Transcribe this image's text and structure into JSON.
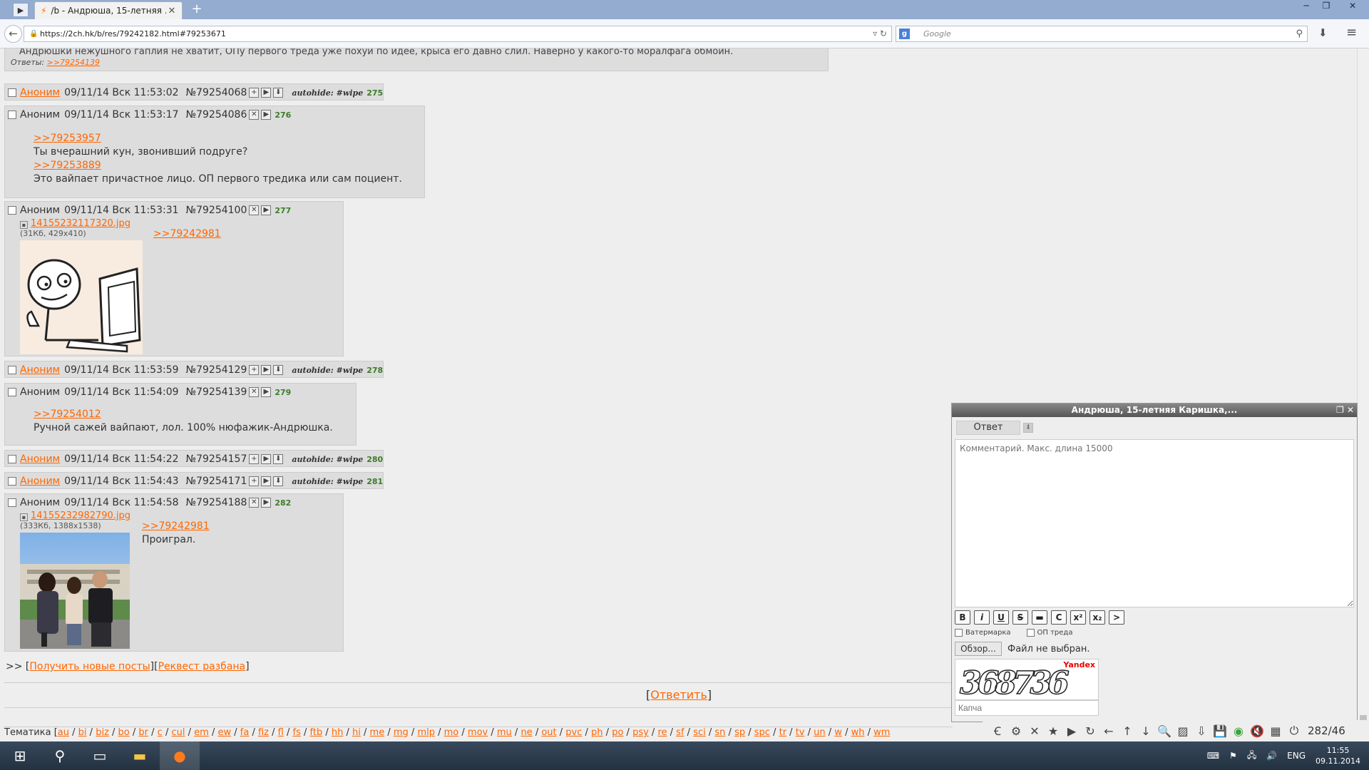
{
  "browser": {
    "tab_title": "/b - Андрюша, 15-летняя ...",
    "url": "https://2ch.hk/b/res/79242182.html#79253671",
    "search_placeholder": "Google"
  },
  "top_post": {
    "text": "Андрюшки нежушного гаплия не хватит, ОПу первого треда уже похуй по идее, крыса его давно слил. Наверно у какого-то моралфага обмоин.",
    "replies_label": "Ответы:",
    "replies_link": ">>79254139"
  },
  "posts": [
    {
      "name": "Аноним",
      "date": "09/11/14 Вск 11:53:02",
      "num": "№79254068",
      "hide": "autohide: #wipe",
      "count": "275"
    },
    {
      "name": "Аноним",
      "date": "09/11/14 Вск 11:53:17",
      "num": "№79254086",
      "count": "276",
      "lines": [
        ">>79253957",
        "Ты вчерашний кун, звонивший подруге?",
        ">>79253889",
        "Это вайпает причастное лицо. ОП первого тредика или сам поциент."
      ]
    },
    {
      "name": "Аноним",
      "date": "09/11/14 Вск 11:53:31",
      "num": "№79254100",
      "count": "277",
      "file": "14155232117320.jpg",
      "file_meta": "(31Кб, 429x410)",
      "lines": [
        ">>79242981"
      ]
    },
    {
      "name": "Аноним",
      "date": "09/11/14 Вск 11:53:59",
      "num": "№79254129",
      "hide": "autohide: #wipe",
      "count": "278"
    },
    {
      "name": "Аноним",
      "date": "09/11/14 Вск 11:54:09",
      "num": "№79254139",
      "count": "279",
      "lines": [
        ">>79254012",
        "Ручной сажей вайпают, лол. 100% нюфажик-Андрюшка."
      ]
    },
    {
      "name": "Аноним",
      "date": "09/11/14 Вск 11:54:22",
      "num": "№79254157",
      "hide": "autohide: #wipe",
      "count": "280"
    },
    {
      "name": "Аноним",
      "date": "09/11/14 Вск 11:54:43",
      "num": "№79254171",
      "hide": "autohide: #wipe",
      "count": "281"
    },
    {
      "name": "Аноним",
      "date": "09/11/14 Вск 11:54:58",
      "num": "№79254188",
      "count": "282",
      "file": "14155232982790.jpg",
      "file_meta": "(333Кб, 1388x1538)",
      "lines": [
        ">>79242981",
        "Проиграл."
      ]
    }
  ],
  "actions": {
    "prefix": ">>",
    "get_new": "Получить новые посты",
    "request_ban": "Реквест разбана",
    "reply": "Ответить"
  },
  "boards_label": "Тематика",
  "boards": [
    "au",
    "bi",
    "biz",
    "bo",
    "br",
    "c",
    "cul",
    "em",
    "ew",
    "fa",
    "fiz",
    "fl",
    "fs",
    "ftb",
    "hh",
    "hi",
    "me",
    "mg",
    "mlp",
    "mo",
    "mov",
    "mu",
    "ne",
    "out",
    "pvc",
    "ph",
    "po",
    "psy",
    "re",
    "sf",
    "sci",
    "sn",
    "sp",
    "spc",
    "tr",
    "tv",
    "un",
    "w",
    "wh",
    "wm"
  ],
  "reply_window": {
    "title": "Андрюша, 15-летняя Каришка,...",
    "tab_label": "Ответ",
    "comment_placeholder": "Комментарий. Макс. длина 15000",
    "format_buttons": [
      "B",
      "i",
      "U",
      "S",
      "▬",
      "C",
      "x²",
      "x₂",
      ">"
    ],
    "watermark_label": "Ватермарка",
    "op_label": "ОП треда",
    "browse_label": "Обзор...",
    "no_file": "Файл не выбран.",
    "captcha_text": "368736",
    "captcha_brand": "Yandex",
    "captcha_placeholder": "Капча"
  },
  "bottom_toolbar": {
    "page_count": "282/46"
  },
  "taskbar": {
    "lang": "ENG",
    "time": "11:55",
    "date": "09.11.2014"
  },
  "colors": {
    "accent": "#ff6600",
    "post_bg": "#dddddd",
    "page_bg": "#eeeeee"
  }
}
